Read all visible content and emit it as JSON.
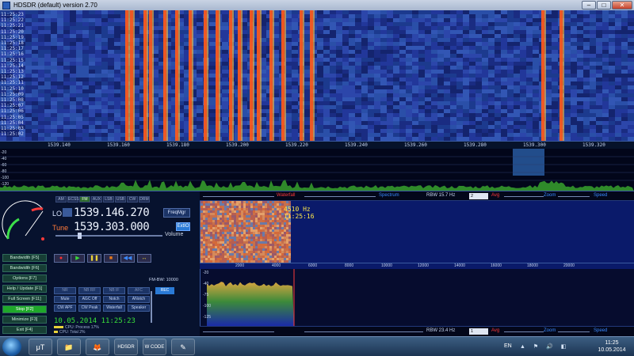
{
  "window": {
    "title": "HDSDR (default)  version 2.70"
  },
  "window_buttons": {
    "minimize": "–",
    "maximize": "□",
    "close": "✕"
  },
  "waterfall": {
    "times": [
      "11:25:23",
      "11:25:22",
      "11:25:21",
      "11:25:20",
      "11:25:19",
      "11:25:18",
      "11:25:17",
      "11:25:16",
      "11:25:15",
      "11:25:14",
      "11:25:13",
      "11:25:12",
      "11:25:11",
      "11:25:10",
      "11:25:09",
      "11:25:08",
      "11:25:07",
      "11:25:06",
      "11:25:05",
      "11:25:04",
      "11:25:03",
      "11:25:02"
    ],
    "freq_labels": [
      "1539.140",
      "1539.160",
      "1539.180",
      "1539.200",
      "1539.220",
      "1539.240",
      "1539.260",
      "1539.280",
      "1539.300",
      "1539.320"
    ]
  },
  "spectrum_db": [
    "-20",
    "-40",
    "-60",
    "-80",
    "-100",
    "-120"
  ],
  "modes": [
    "AM",
    "ECSS",
    "FM",
    "AUX",
    "LSB",
    "USB",
    "CW",
    "DRM"
  ],
  "active_mode": "FM",
  "lo": {
    "label": "LO",
    "freq": "1539.146.270"
  },
  "tune": {
    "label": "Tune",
    "freq": "1539.303.000"
  },
  "buttons": {
    "freqmgr": "FreqMgr",
    "extio": "ExtIO",
    "volume": "Volume"
  },
  "side_buttons": [
    "Bandwidth [F5]",
    "Bandwidth [F6]",
    "Options [F7]",
    "Help / Update [F1]",
    "Full Screen [F11]",
    "Stop [F2]",
    "Minimize [F3]",
    "Exit [F4]"
  ],
  "transport": [
    "●",
    "▶",
    "❚❚",
    "■",
    "◀◀",
    "↔"
  ],
  "dsp_buttons": [
    "NR",
    "NB RF",
    "NB IF",
    "AFC",
    "Mute",
    "AGC Off",
    "Notch",
    "ANotch",
    "CW APF",
    "CW Peak",
    "Waterfall",
    "Speaker"
  ],
  "fm_label": "FM-BW: 10000",
  "rec_button": "REC",
  "datetime": "10.05.2014  11:25:23",
  "cpu": {
    "line1": "CPU: Process  17%",
    "line2": "CPU: Total  2%"
  },
  "audio_bar": {
    "waterfall": "Waterfall",
    "spectrum": "Spectrum",
    "rbw": "RBW 15.7 Hz",
    "avg_value": "2",
    "avg": "Avg",
    "zoom": "Zoom",
    "speed": "Speed"
  },
  "audio_bar_bottom": {
    "rbw": "RBW 23.4 Hz",
    "avg_value": "1",
    "avg": "Avg",
    "zoom": "Zoom",
    "speed": "Speed"
  },
  "audio_freqs": [
    "2000",
    "4000",
    "6000",
    "8000",
    "10000",
    "12000",
    "14000",
    "16000",
    "18000",
    "20000"
  ],
  "audio_db": [
    "-20",
    "-40",
    "-75",
    "-100",
    "-125"
  ],
  "audio_readout": {
    "freq": "4510 Hz",
    "time": "11:25:16"
  },
  "taskbar": {
    "lang": "EN",
    "tray": "▲ ⚑ 🔊 ◧",
    "time": "11:25",
    "date": "10.05.2014"
  },
  "taskbar_apps": [
    "μT",
    "📁",
    "🦊",
    "HDSDR",
    "W CODE",
    "✎"
  ],
  "colors": {
    "waterfall_bg": "#1a2c82",
    "signal": "#ff5a1a",
    "stop": "#1fa82a",
    "datetime": "#39e03a"
  }
}
